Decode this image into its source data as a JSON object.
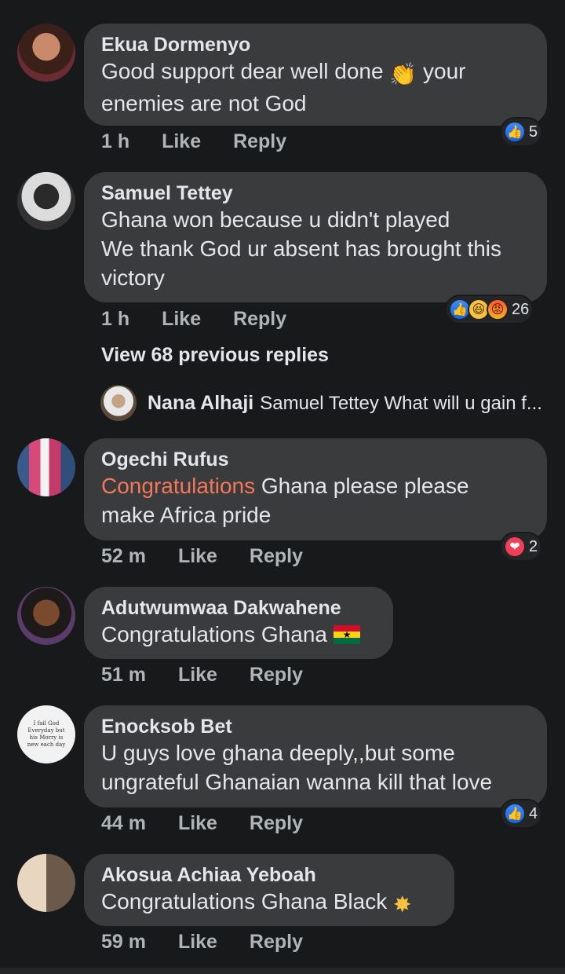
{
  "comments": [
    {
      "name": "Ekua Dormenyo",
      "text1": "Good support dear well done",
      "text2": "your",
      "text3": "enemies are not God",
      "time": "1 h",
      "like": "Like",
      "reply": "Reply",
      "reactions": "5"
    },
    {
      "name": "Samuel Tettey",
      "text1": "Ghana won because u didn't played",
      "text2": "We thank God ur absent has brought this",
      "text3": "victory",
      "time": "1 h",
      "like": "Like",
      "reply": "Reply",
      "reactions": "26"
    },
    {
      "name": "Ogechi Rufus",
      "mention": "Congratulations",
      "text1": "Ghana please please",
      "text2": "make Africa pride",
      "time": "52 m",
      "like": "Like",
      "reply": "Reply",
      "reactions": "2"
    },
    {
      "name": "Adutwumwaa Dakwahene",
      "text1": "Congratulations Ghana",
      "time": "51 m",
      "like": "Like",
      "reply": "Reply"
    },
    {
      "name": "Enocksob Bet",
      "text1": "U guys love ghana deeply,,but some",
      "text2": "ungrateful Ghanaian wanna kill that love",
      "time": "44 m",
      "like": "Like",
      "reply": "Reply",
      "reactions": "4",
      "avatar_text": "I fail God Everyday but his Morry is new each day"
    },
    {
      "name": "Akosua Achiaa Yeboah",
      "text1": "Congratulations Ghana Black",
      "time": "59 m",
      "like": "Like",
      "reply": "Reply"
    }
  ],
  "view_more": "View 68 previous replies",
  "nested_reply": {
    "name": "Nana Alhaji",
    "text": "Samuel Tettey What will u gain f..."
  },
  "colors": {
    "background": "#18191a",
    "bubble": "#3a3b3c",
    "mention": "#f3775a",
    "meta": "#b0b3b8"
  }
}
